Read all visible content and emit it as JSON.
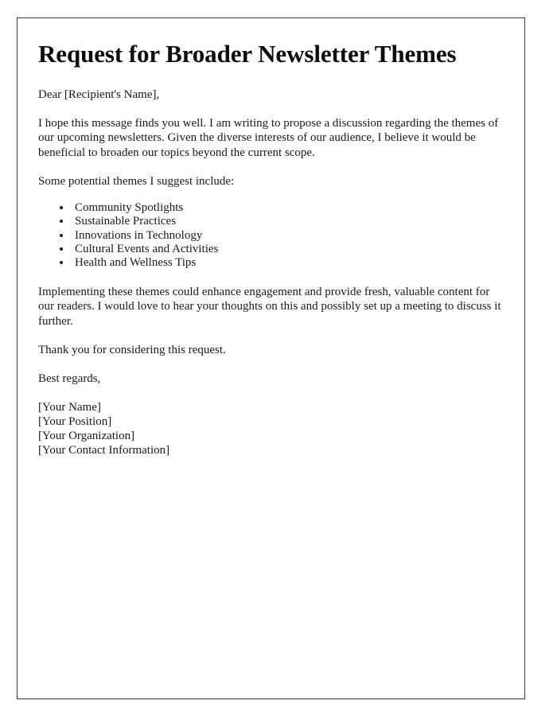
{
  "document": {
    "title": "Request for Broader Newsletter Themes",
    "salutation": "Dear [Recipient's Name],",
    "paragraph_1": "I hope this message finds you well. I am writing to propose a discussion regarding the themes of our upcoming newsletters. Given the diverse interests of our audience, I believe it would be beneficial to broaden our topics beyond the current scope.",
    "list_intro": "Some potential themes I suggest include:",
    "themes": [
      "Community Spotlights",
      "Sustainable Practices",
      "Innovations in Technology",
      "Cultural Events and Activities",
      "Health and Wellness Tips"
    ],
    "paragraph_2": "Implementing these themes could enhance engagement and provide fresh, valuable content for our readers. I would love to hear your thoughts on this and possibly set up a meeting to discuss it further.",
    "thanks": "Thank you for considering this request.",
    "sign_off": "Best regards,",
    "signature": [
      "[Your Name]",
      "[Your Position]",
      "[Your Organization]",
      "[Your Contact Information]"
    ],
    "colors": {
      "text": "#1a1a1a",
      "title": "#0d0d0d",
      "border": "#3a3a3a",
      "background": "#ffffff"
    }
  }
}
